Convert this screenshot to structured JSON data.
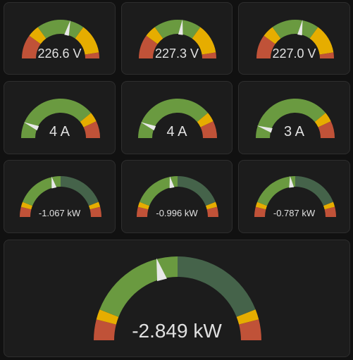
{
  "colors": {
    "page_background": "#111111",
    "card_background": "#1c1c1c",
    "card_border": "#2e2e2e",
    "green": "#6a9a40",
    "green_dim": "#45634a",
    "yellow": "#e6ad00",
    "red": "#c05238",
    "needle": "#e8e8e8",
    "text": "#e1e1e1"
  },
  "voltage_gauges": [
    {
      "label": "226.6 V",
      "fraction": 0.58
    },
    {
      "label": "227.3 V",
      "fraction": 0.54
    },
    {
      "label": "227.0 V",
      "fraction": 0.56
    }
  ],
  "current_gauges": [
    {
      "label": "4 A",
      "fraction": 0.13
    },
    {
      "label": "4 A",
      "fraction": 0.13
    },
    {
      "label": "3 A",
      "fraction": 0.1
    }
  ],
  "power_gauges": [
    {
      "label": "-1.067 kW",
      "fraction": 0.43
    },
    {
      "label": "-0.996 kW",
      "fraction": 0.44
    },
    {
      "label": "-0.787 kW",
      "fraction": 0.46
    }
  ],
  "total_power_gauge": {
    "label": "-2.849 kW",
    "fraction": 0.42
  }
}
